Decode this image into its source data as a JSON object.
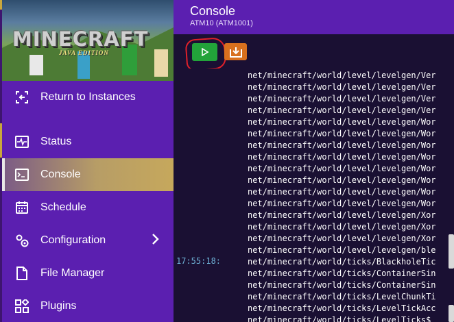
{
  "app": {
    "logo": "MINECRAFT",
    "logo_sub": "JAVA EDITION"
  },
  "sidebar": {
    "items": [
      {
        "label": "Return to Instances",
        "icon": "return-icon"
      },
      {
        "label": "Status",
        "icon": "status-icon"
      },
      {
        "label": "Console",
        "icon": "console-icon",
        "active": true
      },
      {
        "label": "Schedule",
        "icon": "calendar-icon"
      },
      {
        "label": "Configuration",
        "icon": "gear-icon",
        "has_submenu": true
      },
      {
        "label": "File Manager",
        "icon": "file-icon"
      },
      {
        "label": "Plugins",
        "icon": "plugins-icon"
      }
    ]
  },
  "header": {
    "title": "Console",
    "subtitle": "ATM10 (ATM1001)"
  },
  "toolbar": {
    "start_icon": "play-icon",
    "download_icon": "download-icon"
  },
  "console": {
    "timestamp": "17:55:18:",
    "lines": [
      "net/minecraft/world/level/levelgen/Ver",
      "net/minecraft/world/level/levelgen/Ver",
      "net/minecraft/world/level/levelgen/Ver",
      "net/minecraft/world/level/levelgen/Ver",
      "net/minecraft/world/level/levelgen/Wor",
      "net/minecraft/world/level/levelgen/Wor",
      "net/minecraft/world/level/levelgen/Wor",
      "net/minecraft/world/level/levelgen/Wor",
      "net/minecraft/world/level/levelgen/Wor",
      "net/minecraft/world/level/levelgen/Wor",
      "net/minecraft/world/level/levelgen/Wor",
      "net/minecraft/world/level/levelgen/Wor",
      "net/minecraft/world/level/levelgen/Xor",
      "net/minecraft/world/level/levelgen/Xor",
      "net/minecraft/world/level/levelgen/Xor",
      "net/minecraft/world/level/levelgen/ble",
      "net/minecraft/world/ticks/BlackholeTic",
      "net/minecraft/world/ticks/ContainerSin",
      "net/minecraft/world/ticks/ContainerSin",
      "net/minecraft/world/ticks/LevelChunkTi",
      "net/minecraft/world/ticks/LevelTickAcc",
      "net/minecraft/world/ticks/LevelTicks$"
    ]
  },
  "colors": {
    "sidebar": "#5b1fb0",
    "console_bg": "#1a1033",
    "start_button": "#22a33a",
    "download_button": "#d8701e",
    "timestamp": "#6fb3d8"
  }
}
